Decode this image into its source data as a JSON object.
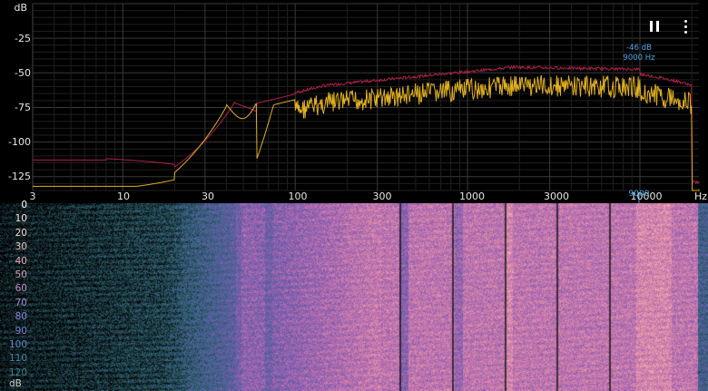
{
  "spectrum": {
    "y_unit": "dB",
    "y_ticks": [
      "-25",
      "-50",
      "-75",
      "-100",
      "-125"
    ],
    "x_unit": "Hz",
    "x_ticks": [
      "3",
      "10",
      "30",
      "100",
      "300",
      "1000",
      "3000",
      "10000"
    ],
    "peak": {
      "db_label": "-46 dB",
      "freq_label": "9000 Hz",
      "cursor_freq": "9000"
    },
    "colors": {
      "peak_hold": "#b0204a",
      "current": "#e0b020",
      "grid": "#2b2b2b",
      "marker": "#4aa4e8"
    }
  },
  "controls": {
    "pause": "pause-icon",
    "more": "more-vert-icon"
  },
  "spectrogram": {
    "scale_labels": [
      "0",
      "10",
      "20",
      "30",
      "40",
      "50",
      "60",
      "70",
      "80",
      "90",
      "100",
      "110",
      "120"
    ],
    "scale_unit": "dB",
    "scale_colors": [
      "#ffffff",
      "#f7e7df",
      "#f1d2cb",
      "#eebfc0",
      "#ecaab8",
      "#dd9abc",
      "#c08ac4",
      "#a887d3",
      "#8c86e0",
      "#6e85dd",
      "#5b88c9",
      "#4a86a8",
      "#3f7a8a"
    ]
  }
}
